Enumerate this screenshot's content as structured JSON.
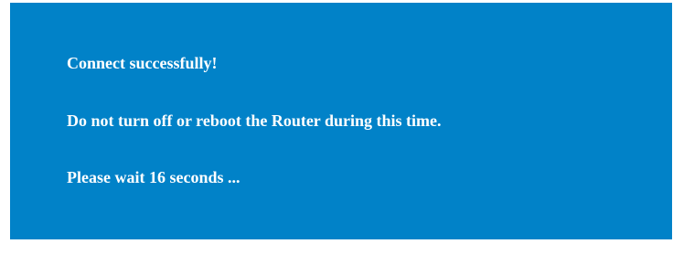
{
  "panel": {
    "background_color": "#0182c8",
    "text_color": "#ffffff"
  },
  "messages": {
    "success": "Connect successfully!",
    "warning": "Do not turn off or reboot the Router during this time.",
    "countdown": "Please wait 16 seconds ..."
  }
}
